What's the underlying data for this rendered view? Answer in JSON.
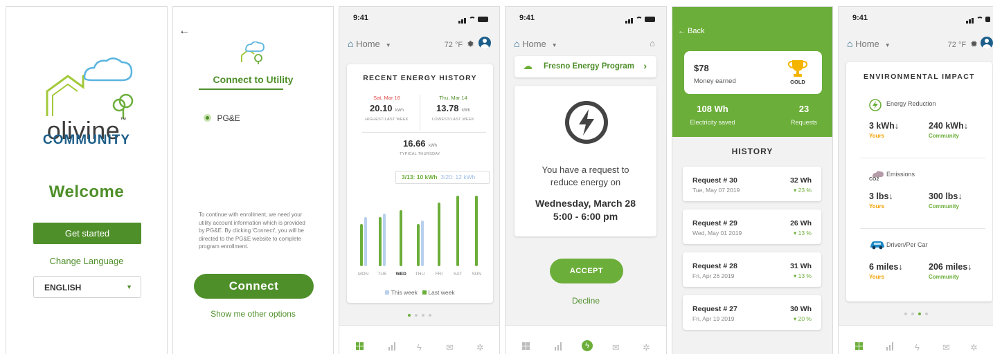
{
  "status": {
    "time": "9:41"
  },
  "screen1": {
    "brand_top": "olivine",
    "brand_tm": "™",
    "brand_bottom": "COMMUNITY",
    "welcome": "Welcome",
    "get_started": "Get started",
    "change_language": "Change Language",
    "language": "ENGLISH"
  },
  "screen2": {
    "back": "←",
    "title": "Connect to Utility",
    "option": "PG&E",
    "info": "To continue with enrollment, we need your utility account information which is provided by PG&E. By clicking 'Connect', you will be directed to the PG&E website to complete program enrollment.",
    "connect": "Connect",
    "other_options": "Show me other options"
  },
  "header": {
    "home": "Home",
    "temp": "72 °F"
  },
  "screen3": {
    "card_title": "RECENT ENERGY HISTORY",
    "highest": {
      "date": "Sat, Mar 16",
      "value": "20.10",
      "unit": "kWh",
      "label": "HIGHEST/LAST WEEK"
    },
    "lowest": {
      "date": "Thu, Mar 14",
      "value": "13.78",
      "unit": "kWh",
      "label": "LOWEST/LAST WEEK"
    },
    "typical": {
      "value": "16.66",
      "unit": "kWh",
      "label": "TYPICAL THURSDAY"
    },
    "tooltip_a": "3/13: 10 kWh",
    "tooltip_b": "3/20: 12 kWh",
    "legend_this": "This week",
    "legend_last": "Last week"
  },
  "chart_data": {
    "type": "bar",
    "categories": [
      "MON",
      "TUE",
      "WED",
      "THU",
      "FRI",
      "SAT",
      "SUN"
    ],
    "highlight": "WED",
    "series": [
      {
        "name": "This week",
        "color": "#b8d0ee",
        "values": [
          14,
          15,
          0,
          13,
          0,
          0,
          0
        ]
      },
      {
        "name": "Last week",
        "color": "#6cae3a",
        "values": [
          12,
          14,
          16,
          12,
          18,
          20,
          20
        ]
      }
    ],
    "ylim": [
      0,
      22
    ]
  },
  "screen4": {
    "program": "Fresno Energy Program",
    "request_line1": "You have a request to",
    "request_line2": "reduce energy on",
    "date": "Wednesday, March 28",
    "time_range": "5:00 - 6:00 pm",
    "accept": "ACCEPT",
    "decline": "Decline"
  },
  "screen5": {
    "back": "← Back",
    "money": "$78",
    "money_label": "Money earned",
    "badge": "GOLD",
    "saved": "108 Wh",
    "saved_label": "Electricity saved",
    "requests": "23",
    "requests_label": "Requests",
    "history_title": "HISTORY",
    "history": [
      {
        "title": "Request # 30",
        "date": "Tue, May 07 2019",
        "value": "32 Wh",
        "change": "▾ 23 %"
      },
      {
        "title": "Request # 29",
        "date": "Wed, May 01 2019",
        "value": "26 Wh",
        "change": "▾ 13 %"
      },
      {
        "title": "Request # 28",
        "date": "Fri, Apr 26 2019",
        "value": "31 Wh",
        "change": "▾ 13 %"
      },
      {
        "title": "Request # 27",
        "date": "Fri, Apr 19 2019",
        "value": "30 Wh",
        "change": "▾ 20 %"
      }
    ]
  },
  "screen6": {
    "title": "ENVIRONMENTAL IMPACT",
    "sections": [
      {
        "name": "Energy Reduction",
        "yours": "3 kWh↓",
        "community": "240 kWh↓"
      },
      {
        "name": "Emissions",
        "yours": "3 lbs↓",
        "community": "300 lbs↓"
      },
      {
        "name": "Driven/Per Car",
        "yours": "6 miles↓",
        "community": "206 miles↓"
      }
    ],
    "co2": "CO2",
    "yours_label": "Yours",
    "community_label": "Community"
  },
  "colors": {
    "accent": "#6cae3a",
    "dark_green": "#4f8f2a",
    "brand_blue": "#1d5f8a",
    "this_week": "#b8d0ee"
  }
}
